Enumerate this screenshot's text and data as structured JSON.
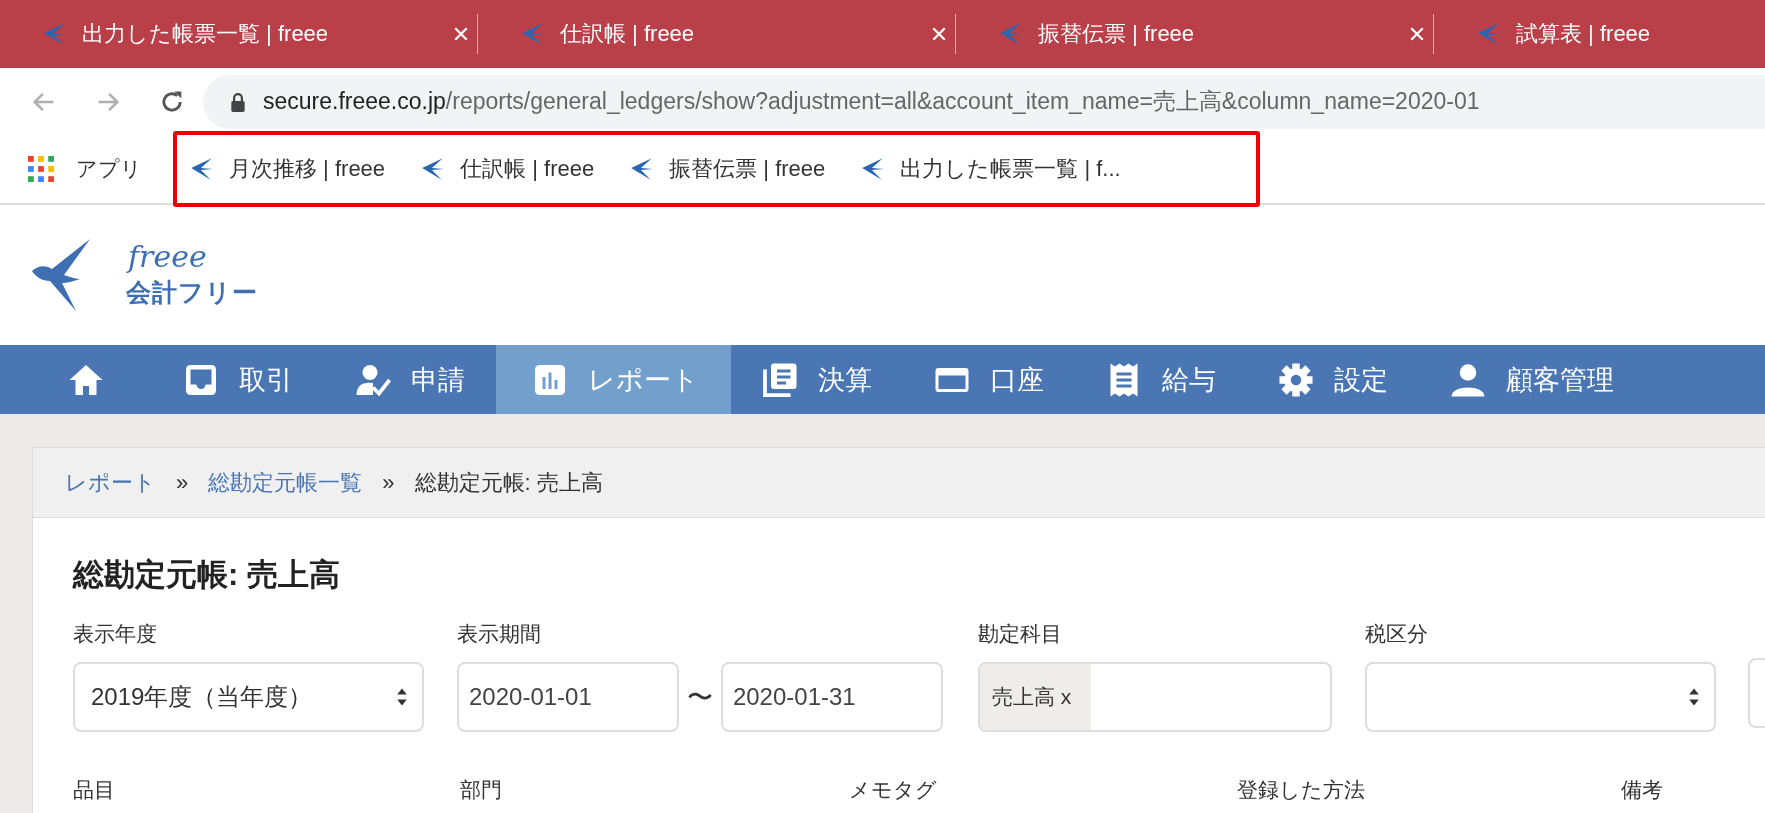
{
  "browser_tabs": [
    {
      "title": "出力した帳票一覧 | freee",
      "closable": true
    },
    {
      "title": "仕訳帳 | freee",
      "closable": true
    },
    {
      "title": "振替伝票 | freee",
      "closable": true
    },
    {
      "title": "試算表 | freee"
    }
  ],
  "address_bar": {
    "host": "secure.freee.co.jp",
    "path": "/reports/general_ledgers/show?adjustment=all&account_item_name=売上高&column_name=2020-01"
  },
  "bookmarks_bar": {
    "apps_label": "アプリ",
    "highlighted": true,
    "items": [
      "月次推移 | freee",
      "仕訳帳 | freee",
      "振替伝票 | freee",
      "出力した帳票一覧 | f..."
    ]
  },
  "logo": {
    "script": "freee",
    "name": "会計フリー"
  },
  "nav": [
    {
      "selected": false
    },
    {
      "label": "取引",
      "selected": false
    },
    {
      "label": "申請",
      "selected": false
    },
    {
      "label": "レポート",
      "selected": true
    },
    {
      "label": "決算",
      "selected": false
    },
    {
      "label": "口座",
      "selected": false
    },
    {
      "label": "給与",
      "selected": false
    },
    {
      "label": "設定",
      "selected": false
    },
    {
      "label": "顧客管理",
      "selected": false
    }
  ],
  "breadcrumb": [
    {
      "kind": "link",
      "label": "レポート"
    },
    {
      "kind": "separator",
      "label": "»"
    },
    {
      "kind": "link",
      "label": "総勘定元帳一覧"
    },
    {
      "kind": "separator",
      "label": "»"
    },
    {
      "kind": "current",
      "label": "総勘定元帳: 売上高"
    }
  ],
  "title": "総勘定元帳: 売上高",
  "filters": [
    {
      "kind": "select",
      "label": "表示年度",
      "value": "2019年度（当年度）"
    },
    {
      "kind": "date_range",
      "label": "表示期間",
      "from": "2020-01-01",
      "separator": "〜",
      "to": "2020-01-31"
    },
    {
      "kind": "tags",
      "label": "勘定科目",
      "tags": [
        "売上高 x"
      ]
    },
    {
      "kind": "select",
      "label": "税区分"
    },
    {
      "kind": "partial"
    }
  ],
  "more_filter_labels": [
    "品目",
    "部門",
    "メモタグ",
    "登録した方法",
    "備考"
  ]
}
